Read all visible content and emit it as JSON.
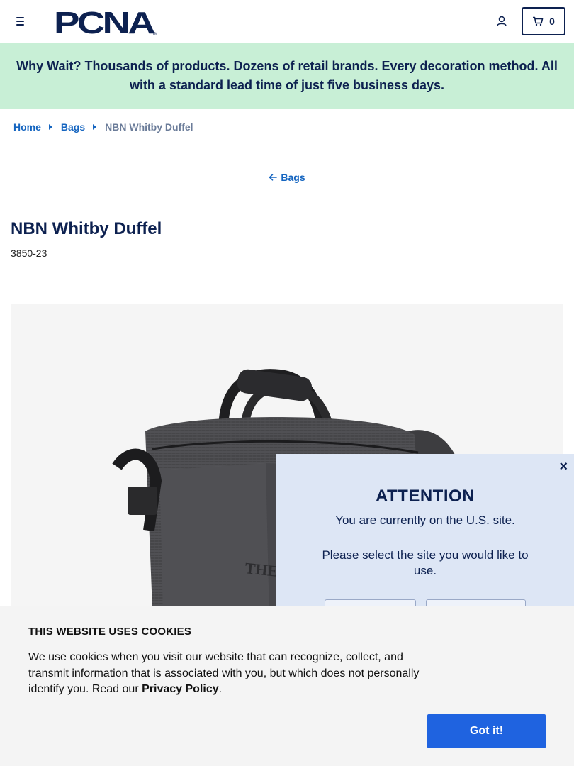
{
  "header": {
    "logo_text": "PCNA",
    "logo_tm": "TM",
    "cart_count": "0",
    "brand_color": "#0d2150",
    "accent_color": "#1565c0"
  },
  "banner": {
    "text": "Why Wait? Thousands of products. Dozens of retail brands. Every decoration method. All with a standard lead time of just five business days.",
    "background": "#c8efd6"
  },
  "breadcrumb": {
    "items": [
      {
        "label": "Home"
      },
      {
        "label": "Bags"
      }
    ],
    "current": "NBN Whitby Duffel"
  },
  "back_link": {
    "label": "Bags"
  },
  "product": {
    "title": "NBN Whitby Duffel",
    "sku": "3850-23",
    "image_alt_icon": "duffel-bag-image"
  },
  "region_popup": {
    "title": "ATTENTION",
    "line1": "You are currently on the U.S. site.",
    "line2": "Please select the site you would like to use.",
    "background": "#dde6f5"
  },
  "cookie_banner": {
    "title": "THIS WEBSITE USES COOKIES",
    "text": "We use cookies when you visit our website that can recognize, collect, and transmit information that is associated with you, but which does not personally identify you. Read our ",
    "link_label": "Privacy Policy",
    "period": ".",
    "button_label": "Got it!",
    "button_color": "#1f63e0"
  }
}
